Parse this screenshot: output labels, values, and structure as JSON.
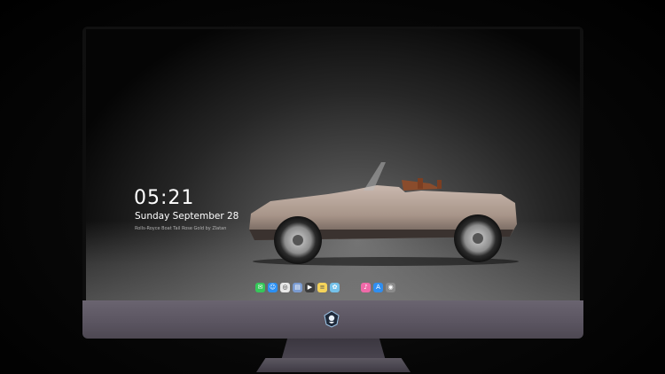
{
  "lockscreen": {
    "time": "05:21",
    "date": "Sunday September 28",
    "caption": "Rolls-Royce Boat Tail Rose Gold by Zlatan"
  },
  "dock": {
    "items": [
      {
        "name": "messages-icon",
        "color": "#35c759",
        "glyph": "✉"
      },
      {
        "name": "finder-icon",
        "color": "#2a8ff2",
        "glyph": "☺"
      },
      {
        "name": "safari-icon",
        "color": "#e8e8e8",
        "glyph": "◎"
      },
      {
        "name": "preview-icon",
        "color": "#7a9bd1",
        "glyph": "▤"
      },
      {
        "name": "final-cut-icon",
        "color": "#3b3b3b",
        "glyph": "▶"
      },
      {
        "name": "notes-icon",
        "color": "#f5d35a",
        "glyph": "≡"
      },
      {
        "name": "photos-icon",
        "color": "#74c1ea",
        "glyph": "✿"
      },
      {
        "name": "itunes-icon",
        "color": "#f06aa9",
        "glyph": "♪"
      },
      {
        "name": "app-store-icon",
        "color": "#2f8ef0",
        "glyph": "A"
      },
      {
        "name": "camera-icon",
        "color": "#8a8a8a",
        "glyph": "◉"
      }
    ]
  }
}
